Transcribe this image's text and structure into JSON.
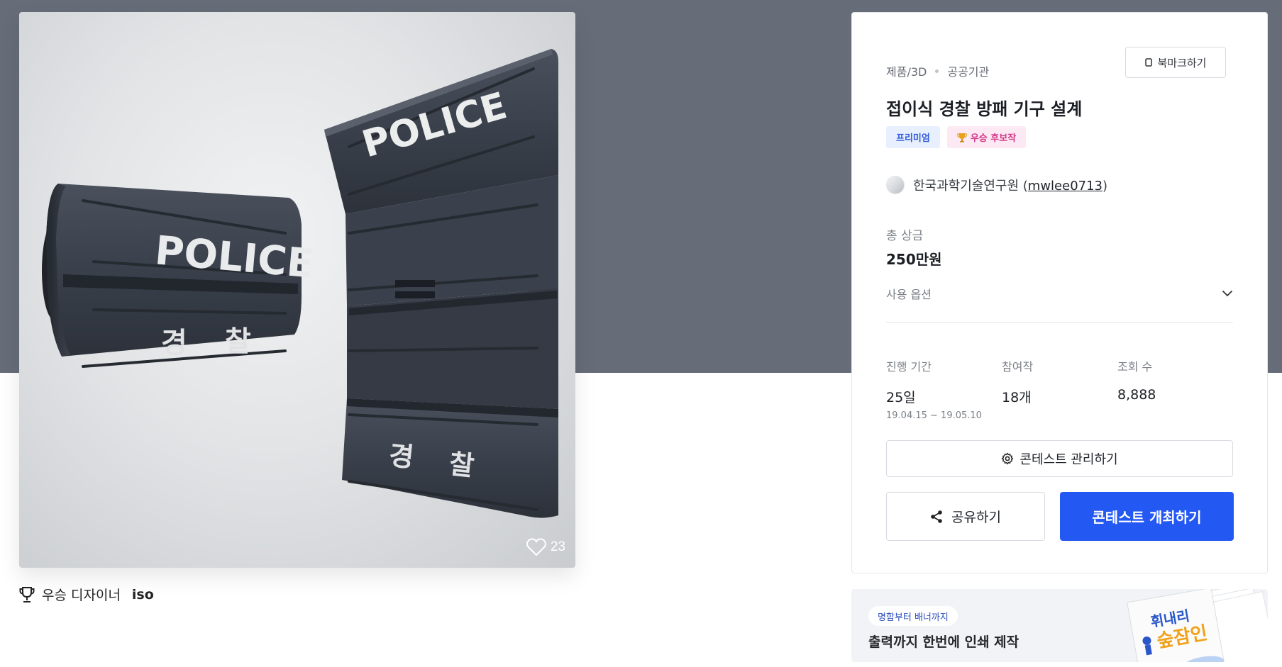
{
  "image": {
    "alt": "접이식 경찰 방패 기구 설계",
    "like_count": "23",
    "shield_text_en": "POLICE",
    "shield_text_ko_1": "경",
    "shield_text_ko_2": "찰"
  },
  "winner": {
    "label": "우승 디자이너",
    "name": "iso"
  },
  "contest": {
    "category": "제품/3D",
    "subcategory": "공공기관",
    "bookmark_label": "북마크하기",
    "title": "접이식 경찰 방패 기구 설계",
    "badges": [
      {
        "label": "프리미엄"
      },
      {
        "label": "우승 후보작",
        "icon": "trophy-icon"
      }
    ],
    "host_name": "한국과학기술연구원",
    "host_id": "mwlee0713",
    "prize_label": "총 상금",
    "prize_value": "250만원",
    "option_label": "사용 옵션",
    "stats": {
      "period_label": "진행 기간",
      "period_value": "25일",
      "period_range": "19.04.15 ~ 19.05.10",
      "entries_label": "참여작",
      "entries_value": "18개",
      "views_label": "조회 수",
      "views_value": "8,888"
    },
    "manage_label": "콘테스트 관리하기",
    "share_label": "공유하기",
    "host_contest_label": "콘테스트 개최하기"
  },
  "ad": {
    "tag": "명함부터 배너까지",
    "title": "출력까지 한번에 인쇄 제작",
    "art_text_1": "휘내리",
    "art_text_2": "숲잠인"
  },
  "colors": {
    "hero_band": "#666d79",
    "primary": "#2458f2",
    "premium_badge_bg": "#e8efff",
    "finalist_badge_bg": "#fde9f3"
  }
}
